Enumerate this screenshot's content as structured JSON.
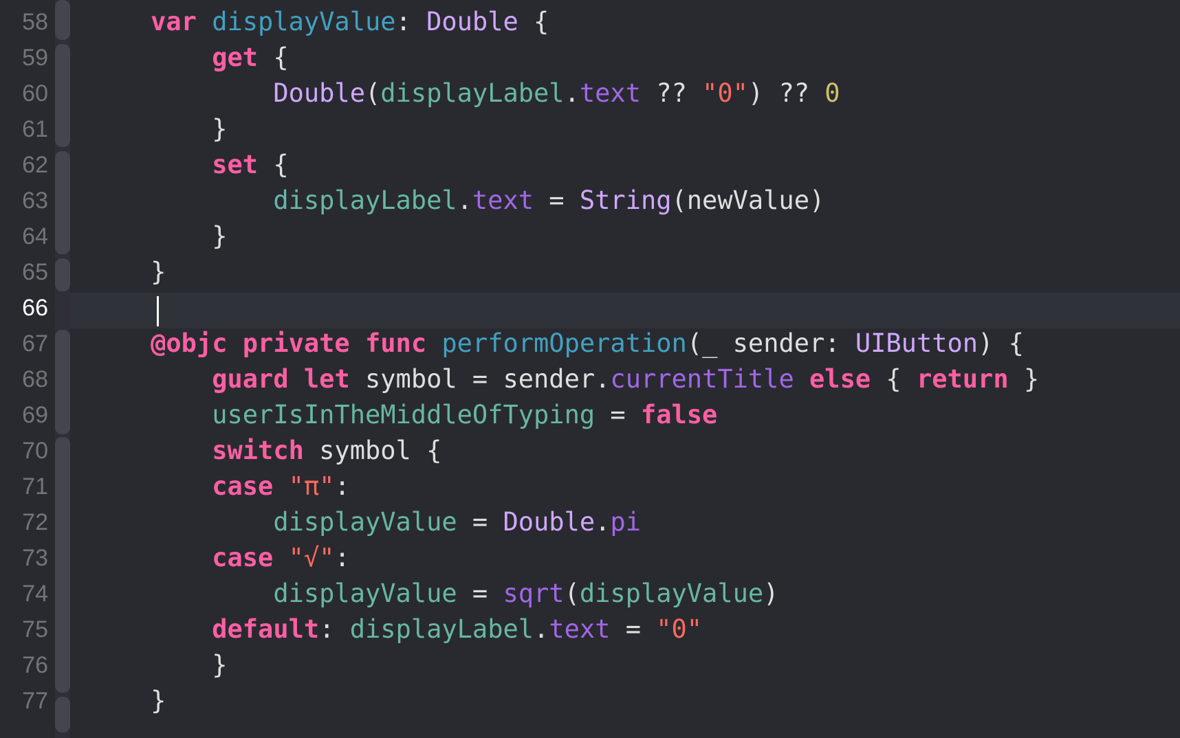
{
  "editor": {
    "current_line": "66",
    "colors": {
      "background": "#292a30",
      "keyword": "#fc5fa3",
      "type": "#d0a8ff",
      "declaration": "#41a1c0",
      "project_property": "#67b7a4",
      "member": "#a167e6",
      "string": "#fc6a5d",
      "number": "#d0bf69",
      "plain": "#dfdfe0",
      "line_number": "#747478"
    },
    "lines": [
      {
        "number": "58",
        "tokens": [
          [
            "pl",
            "    "
          ],
          [
            "kw",
            "var"
          ],
          [
            "pl",
            " "
          ],
          [
            "decl",
            "displayValue"
          ],
          [
            "pl",
            ": "
          ],
          [
            "ty",
            "Double"
          ],
          [
            "pl",
            " {"
          ]
        ]
      },
      {
        "number": "59",
        "tokens": [
          [
            "pl",
            "        "
          ],
          [
            "kw",
            "get"
          ],
          [
            "pl",
            " {"
          ]
        ]
      },
      {
        "number": "60",
        "tokens": [
          [
            "pl",
            "            "
          ],
          [
            "ty",
            "Double"
          ],
          [
            "pl",
            "("
          ],
          [
            "prop",
            "displayLabel"
          ],
          [
            "pl",
            "."
          ],
          [
            "mem",
            "text"
          ],
          [
            "pl",
            " ?? "
          ],
          [
            "str",
            "\"0\""
          ],
          [
            "pl",
            ") ?? "
          ],
          [
            "num",
            "0"
          ]
        ]
      },
      {
        "number": "61",
        "tokens": [
          [
            "pl",
            "        }"
          ]
        ]
      },
      {
        "number": "62",
        "tokens": [
          [
            "pl",
            "        "
          ],
          [
            "kw",
            "set"
          ],
          [
            "pl",
            " {"
          ]
        ]
      },
      {
        "number": "63",
        "tokens": [
          [
            "pl",
            "            "
          ],
          [
            "prop",
            "displayLabel"
          ],
          [
            "pl",
            "."
          ],
          [
            "mem",
            "text"
          ],
          [
            "pl",
            " = "
          ],
          [
            "ty",
            "String"
          ],
          [
            "pl",
            "(newValue)"
          ]
        ]
      },
      {
        "number": "64",
        "tokens": [
          [
            "pl",
            "        }"
          ]
        ]
      },
      {
        "number": "65",
        "tokens": [
          [
            "pl",
            "    }"
          ]
        ]
      },
      {
        "number": "66",
        "tokens": []
      },
      {
        "number": "67",
        "tokens": [
          [
            "pl",
            "    "
          ],
          [
            "kw",
            "@objc"
          ],
          [
            "pl",
            " "
          ],
          [
            "kw",
            "private"
          ],
          [
            "pl",
            " "
          ],
          [
            "kw",
            "func"
          ],
          [
            "pl",
            " "
          ],
          [
            "decl",
            "performOperation"
          ],
          [
            "pl",
            "(_ sender: "
          ],
          [
            "ty",
            "UIButton"
          ],
          [
            "pl",
            ") {"
          ]
        ]
      },
      {
        "number": "68",
        "tokens": [
          [
            "pl",
            "        "
          ],
          [
            "kw",
            "guard"
          ],
          [
            "pl",
            " "
          ],
          [
            "kw",
            "let"
          ],
          [
            "pl",
            " symbol = sender."
          ],
          [
            "mem",
            "currentTitle"
          ],
          [
            "pl",
            " "
          ],
          [
            "kw",
            "else"
          ],
          [
            "pl",
            " { "
          ],
          [
            "kw",
            "return"
          ],
          [
            "pl",
            " }"
          ]
        ]
      },
      {
        "number": "69",
        "tokens": [
          [
            "pl",
            "        "
          ],
          [
            "prop",
            "userIsInTheMiddleOfTyping"
          ],
          [
            "pl",
            " = "
          ],
          [
            "kw",
            "false"
          ]
        ]
      },
      {
        "number": "70",
        "tokens": [
          [
            "pl",
            "        "
          ],
          [
            "kw",
            "switch"
          ],
          [
            "pl",
            " symbol {"
          ]
        ]
      },
      {
        "number": "71",
        "tokens": [
          [
            "pl",
            "        "
          ],
          [
            "kw",
            "case"
          ],
          [
            "pl",
            " "
          ],
          [
            "str",
            "\"π\""
          ],
          [
            "pl",
            ":"
          ]
        ]
      },
      {
        "number": "72",
        "tokens": [
          [
            "pl",
            "            "
          ],
          [
            "prop",
            "displayValue"
          ],
          [
            "pl",
            " = "
          ],
          [
            "ty",
            "Double"
          ],
          [
            "pl",
            "."
          ],
          [
            "mem",
            "pi"
          ]
        ]
      },
      {
        "number": "73",
        "tokens": [
          [
            "pl",
            "        "
          ],
          [
            "kw",
            "case"
          ],
          [
            "pl",
            " "
          ],
          [
            "str",
            "\"√\""
          ],
          [
            "pl",
            ":"
          ]
        ]
      },
      {
        "number": "74",
        "tokens": [
          [
            "pl",
            "            "
          ],
          [
            "prop",
            "displayValue"
          ],
          [
            "pl",
            " = "
          ],
          [
            "mem",
            "sqrt"
          ],
          [
            "pl",
            "("
          ],
          [
            "prop",
            "displayValue"
          ],
          [
            "pl",
            ")"
          ]
        ]
      },
      {
        "number": "75",
        "tokens": [
          [
            "pl",
            "        "
          ],
          [
            "kw",
            "default"
          ],
          [
            "pl",
            ": "
          ],
          [
            "prop",
            "displayLabel"
          ],
          [
            "pl",
            "."
          ],
          [
            "mem",
            "text"
          ],
          [
            "pl",
            " = "
          ],
          [
            "str",
            "\"0\""
          ]
        ]
      },
      {
        "number": "76",
        "tokens": [
          [
            "pl",
            "        }"
          ]
        ]
      },
      {
        "number": "77",
        "tokens": [
          [
            "pl",
            "    }"
          ]
        ]
      }
    ]
  }
}
